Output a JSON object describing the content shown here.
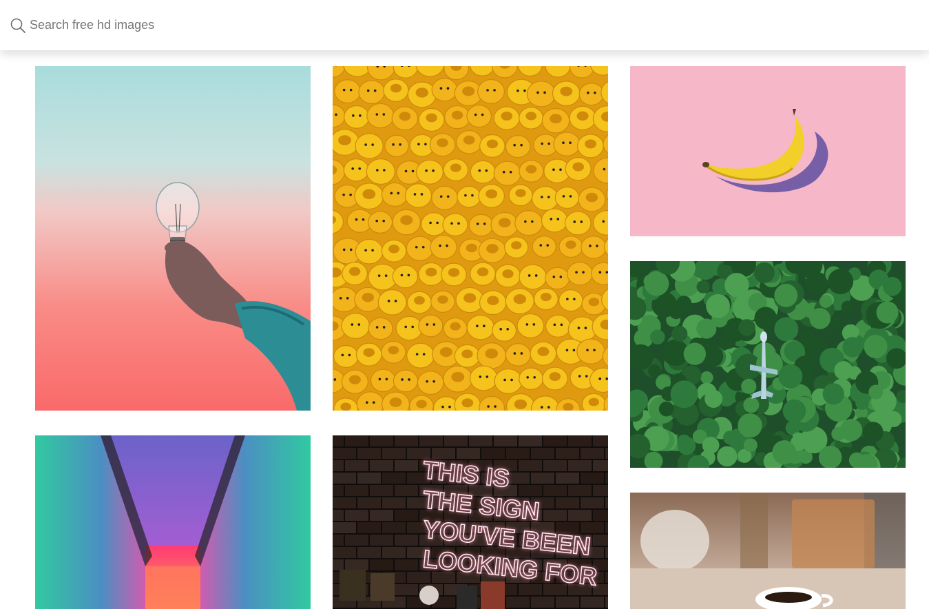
{
  "search": {
    "placeholder": "Search free hd images",
    "value": "",
    "icon": "search-icon"
  },
  "gallery": {
    "images": [
      {
        "name": "lightbulb-hand-photo",
        "description_icon": "photo"
      },
      {
        "name": "lego-heads-photo",
        "description_icon": "photo"
      },
      {
        "name": "banana-pink-photo",
        "description_icon": "photo"
      },
      {
        "name": "forest-airplane-photo",
        "description_icon": "photo"
      },
      {
        "name": "neon-corridor-photo",
        "description_icon": "photo"
      },
      {
        "name": "neon-sign-photo",
        "description_icon": "photo"
      },
      {
        "name": "coffee-table-photo",
        "description_icon": "photo"
      }
    ],
    "neon_sign_text": [
      "THIS IS",
      "THE SIGN",
      "YOU'VE BEEN",
      "LOOKING FOR"
    ]
  },
  "colors": {
    "header_bg": "#ffffff",
    "placeholder": "#757575",
    "banana_bg": "#f6b7c8",
    "forest_green": "#2f6b3a",
    "lego_yellow": "#f5b720"
  }
}
